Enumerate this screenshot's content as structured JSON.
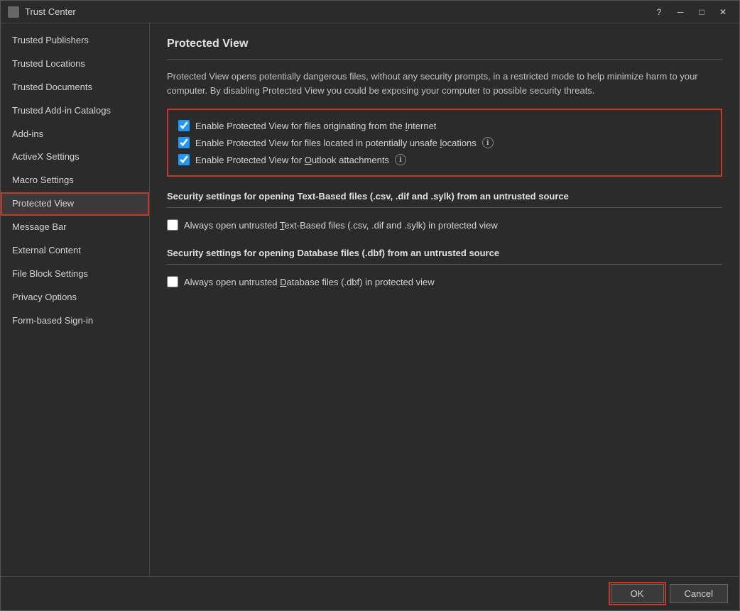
{
  "window": {
    "title": "Trust Center",
    "help_label": "?",
    "close_label": "✕",
    "minimize_label": "─",
    "maximize_label": "□"
  },
  "sidebar": {
    "items": [
      {
        "id": "trusted-publishers",
        "label": "Trusted Publishers",
        "active": false
      },
      {
        "id": "trusted-locations",
        "label": "Trusted Locations",
        "active": false
      },
      {
        "id": "trusted-documents",
        "label": "Trusted Documents",
        "active": false
      },
      {
        "id": "trusted-add-in-catalogs",
        "label": "Trusted Add-in Catalogs",
        "active": false
      },
      {
        "id": "add-ins",
        "label": "Add-ins",
        "active": false
      },
      {
        "id": "activex-settings",
        "label": "ActiveX Settings",
        "active": false
      },
      {
        "id": "macro-settings",
        "label": "Macro Settings",
        "active": false
      },
      {
        "id": "protected-view",
        "label": "Protected View",
        "active": true
      },
      {
        "id": "message-bar",
        "label": "Message Bar",
        "active": false
      },
      {
        "id": "external-content",
        "label": "External Content",
        "active": false
      },
      {
        "id": "file-block-settings",
        "label": "File Block Settings",
        "active": false
      },
      {
        "id": "privacy-options",
        "label": "Privacy Options",
        "active": false
      },
      {
        "id": "form-based-sign-in",
        "label": "Form-based Sign-in",
        "active": false
      }
    ]
  },
  "main": {
    "title": "Protected View",
    "description": "Protected View opens potentially dangerous files, without any security prompts, in a restricted mode to help minimize harm to your computer. By disabling Protected View you could be exposing your computer to possible security threats.",
    "checkboxes": {
      "group": [
        {
          "id": "cb-internet",
          "label": "Enable Protected View for files originating from the Internet",
          "checked": true,
          "has_info": false,
          "underline_char": "I"
        },
        {
          "id": "cb-unsafe-locations",
          "label": "Enable Protected View for files located in potentially unsafe locations",
          "checked": true,
          "has_info": true,
          "underline_char": "l"
        },
        {
          "id": "cb-outlook",
          "label": "Enable Protected View for Outlook attachments",
          "checked": true,
          "has_info": true,
          "underline_char": "O"
        }
      ]
    },
    "text_based_section": {
      "title": "Security settings for opening Text-Based files (.csv, .dif and .sylk) from an untrusted source",
      "checkbox": {
        "id": "cb-text-based",
        "label": "Always open untrusted Text-Based files (.csv, .dif and .sylk) in protected view",
        "checked": false
      }
    },
    "database_section": {
      "title": "Security settings for opening Database files (.dbf) from an untrusted source",
      "checkbox": {
        "id": "cb-database",
        "label": "Always open untrusted Database files (.dbf) in protected view",
        "checked": false
      }
    }
  },
  "footer": {
    "ok_label": "OK",
    "cancel_label": "Cancel"
  },
  "colors": {
    "accent_red": "#c0392b",
    "bg_dark": "#2b2b2b",
    "text_light": "#d4d4d4"
  }
}
